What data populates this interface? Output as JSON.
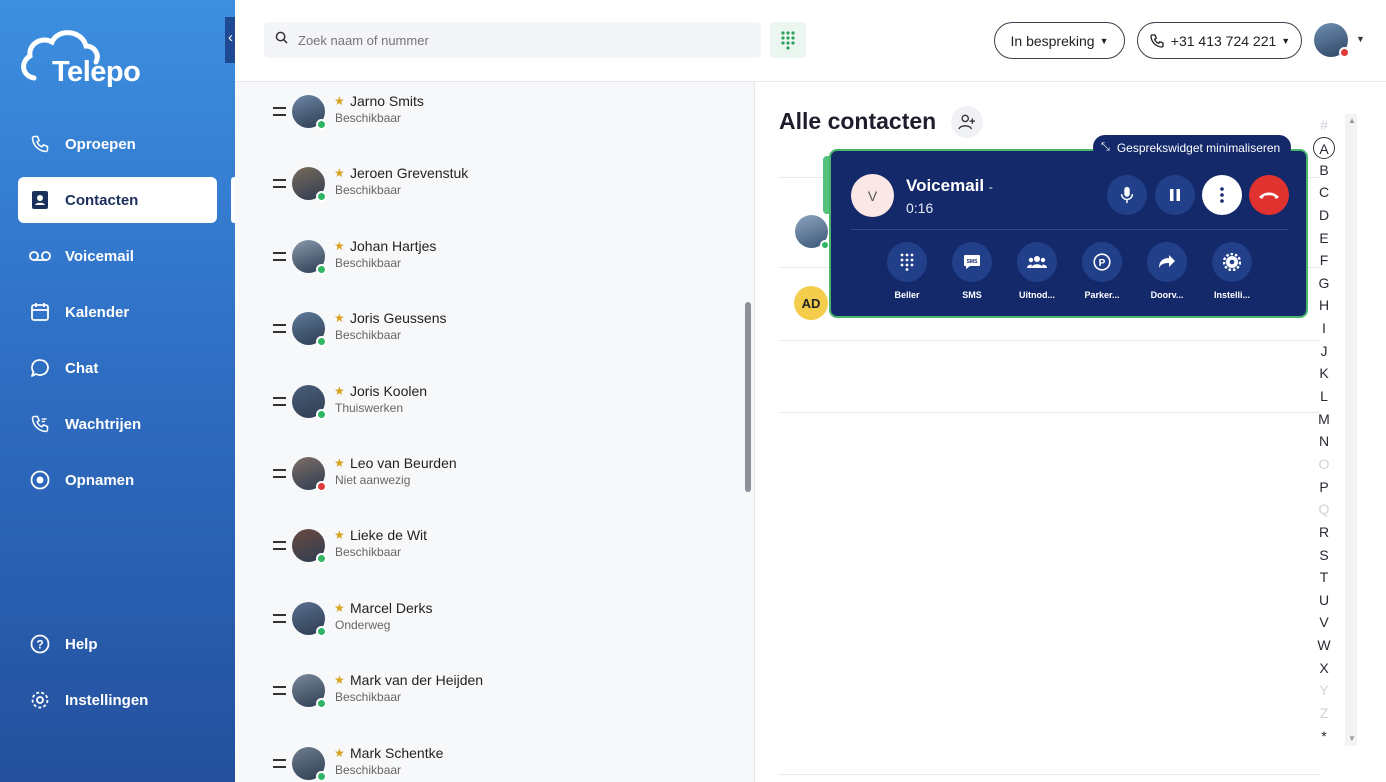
{
  "app": {
    "brand": "Telepo"
  },
  "sidebar": {
    "items": [
      {
        "label": "Oproepen",
        "icon": "phone-icon"
      },
      {
        "label": "Contacten",
        "icon": "contact-book-icon",
        "active": true
      },
      {
        "label": "Voicemail",
        "icon": "voicemail-icon"
      },
      {
        "label": "Kalender",
        "icon": "calendar-icon"
      },
      {
        "label": "Chat",
        "icon": "chat-icon"
      },
      {
        "label": "Wachtrijen",
        "icon": "queue-phone-icon"
      },
      {
        "label": "Opnamen",
        "icon": "record-icon"
      }
    ],
    "bottom": [
      {
        "label": "Help",
        "icon": "help-icon"
      },
      {
        "label": "Instellingen",
        "icon": "gear-icon"
      }
    ]
  },
  "topbar": {
    "search_placeholder": "Zoek naam of nummer",
    "status": "In bespreking",
    "phone_number": "+31 413 724 221"
  },
  "favorites": [
    {
      "name": "Jarno Smits",
      "status": "Beschikbaar",
      "presence": "available"
    },
    {
      "name": "Jeroen Grevenstuk",
      "status": "Beschikbaar",
      "presence": "available"
    },
    {
      "name": "Johan Hartjes",
      "status": "Beschikbaar",
      "presence": "available"
    },
    {
      "name": "Joris Geussens",
      "status": "Beschikbaar",
      "presence": "available"
    },
    {
      "name": "Joris Koolen",
      "status": "Thuiswerken",
      "presence": "available"
    },
    {
      "name": "Leo van Beurden",
      "status": "Niet aanwezig",
      "presence": "busy"
    },
    {
      "name": "Lieke de Wit",
      "status": "Beschikbaar",
      "presence": "available"
    },
    {
      "name": "Marcel Derks",
      "status": "Onderweg",
      "presence": "available"
    },
    {
      "name": "Mark van der Heijden",
      "status": "Beschikbaar",
      "presence": "available"
    },
    {
      "name": "Mark Schentke",
      "status": "Beschikbaar",
      "presence": "available"
    }
  ],
  "contacts": {
    "title": "Alle contacten",
    "initials_avatar": "AD"
  },
  "alphabet": {
    "letters": [
      "#",
      "A",
      "B",
      "C",
      "D",
      "E",
      "F",
      "G",
      "H",
      "I",
      "J",
      "K",
      "L",
      "M",
      "N",
      "O",
      "P",
      "Q",
      "R",
      "S",
      "T",
      "U",
      "V",
      "W",
      "X",
      "Y",
      "Z",
      "*"
    ],
    "dimmed": [
      "#",
      "O",
      "Q",
      "Y",
      "Z"
    ],
    "selected": "A"
  },
  "call_widget": {
    "minimize_label": "Gesprekswidget minimaliseren",
    "avatar_initial": "V",
    "caller": "Voicemail",
    "duration": "0:16",
    "actions": [
      "Beller",
      "SMS",
      "Uitnod...",
      "Parker...",
      "Doorv...",
      "Instelli..."
    ]
  },
  "colors": {
    "sidebar_top": "#3d8fe0",
    "sidebar_bottom": "#24509d",
    "widget_bg": "#13296a",
    "widget_border": "#49b56d",
    "hangup": "#e0322e",
    "available": "#2fb564",
    "busy": "#e03b3b"
  }
}
